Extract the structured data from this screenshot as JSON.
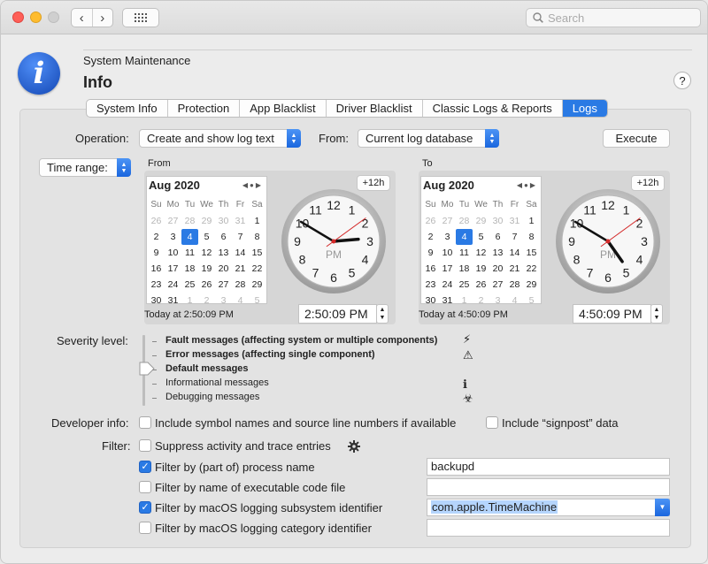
{
  "toolbar": {
    "back": "‹",
    "forward": "›",
    "search_placeholder": "Search"
  },
  "header": {
    "icon_letter": "i",
    "section": "System Maintenance",
    "title": "Info",
    "help": "?"
  },
  "tabs": [
    {
      "label": "System Info"
    },
    {
      "label": "Protection"
    },
    {
      "label": "App Blacklist"
    },
    {
      "label": "Driver Blacklist"
    },
    {
      "label": "Classic Logs & Reports"
    },
    {
      "label": "Logs",
      "active": true
    }
  ],
  "operation": {
    "label": "Operation:",
    "value": "Create and show log text",
    "from_label": "From:",
    "from_value": "Current log database",
    "execute": "Execute"
  },
  "time_range": {
    "popup": "Time range:",
    "from": {
      "label": "From",
      "month": "Aug 2020",
      "plus12": "+12h",
      "today": "Today at 2:50:09 PM",
      "time": "2:50:09 PM",
      "clock": {
        "hour": 2,
        "minute": 50,
        "second": 9,
        "period": "PM"
      }
    },
    "to": {
      "label": "To",
      "month": "Aug 2020",
      "plus12": "+12h",
      "today": "Today at 4:50:09 PM",
      "time": "4:50:09 PM",
      "clock": {
        "hour": 4,
        "minute": 50,
        "second": 9,
        "period": "PM"
      }
    },
    "weekdays": [
      "Su",
      "Mo",
      "Tu",
      "We",
      "Th",
      "Fr",
      "Sa"
    ],
    "days": [
      [
        "26",
        "27",
        "28",
        "29",
        "30",
        "31",
        "1"
      ],
      [
        "2",
        "3",
        "4",
        "5",
        "6",
        "7",
        "8"
      ],
      [
        "9",
        "10",
        "11",
        "12",
        "13",
        "14",
        "15"
      ],
      [
        "16",
        "17",
        "18",
        "19",
        "20",
        "21",
        "22"
      ],
      [
        "23",
        "24",
        "25",
        "26",
        "27",
        "28",
        "29"
      ],
      [
        "30",
        "31",
        "1",
        "2",
        "3",
        "4",
        "5"
      ]
    ],
    "selected_day": "4"
  },
  "severity": {
    "label": "Severity level:",
    "levels": [
      {
        "text": "Fault messages (affecting system or multiple components)",
        "bold": true,
        "icon": "⚡"
      },
      {
        "text": "Error messages (affecting single component)",
        "bold": true,
        "icon": "⚠"
      },
      {
        "text": "Default messages",
        "bold": true,
        "icon": ""
      },
      {
        "text": "Informational messages",
        "bold": false,
        "icon": "ℹ"
      },
      {
        "text": "Debugging messages",
        "bold": false,
        "icon": "☣"
      }
    ],
    "selected_index": 2
  },
  "developer": {
    "label": "Developer info:",
    "symbol_names": "Include symbol names and source line numbers if available",
    "symbol_checked": false,
    "signpost": "Include “signpost” data",
    "signpost_checked": false
  },
  "filter": {
    "label": "Filter:",
    "suppress": "Suppress activity and trace entries",
    "suppress_checked": false,
    "rows": [
      {
        "label": "Filter by (part of) process name",
        "checked": true,
        "value": "backupd"
      },
      {
        "label": "Filter by name of executable code file",
        "checked": false,
        "value": ""
      },
      {
        "label": "Filter by macOS logging subsystem identifier",
        "checked": true,
        "value": "com.apple.TimeMachine"
      },
      {
        "label": "Filter by macOS logging category identifier",
        "checked": false,
        "value": ""
      }
    ]
  },
  "colors": {
    "accent": "#2a7ae4",
    "second_hand": "#d42a2a"
  }
}
